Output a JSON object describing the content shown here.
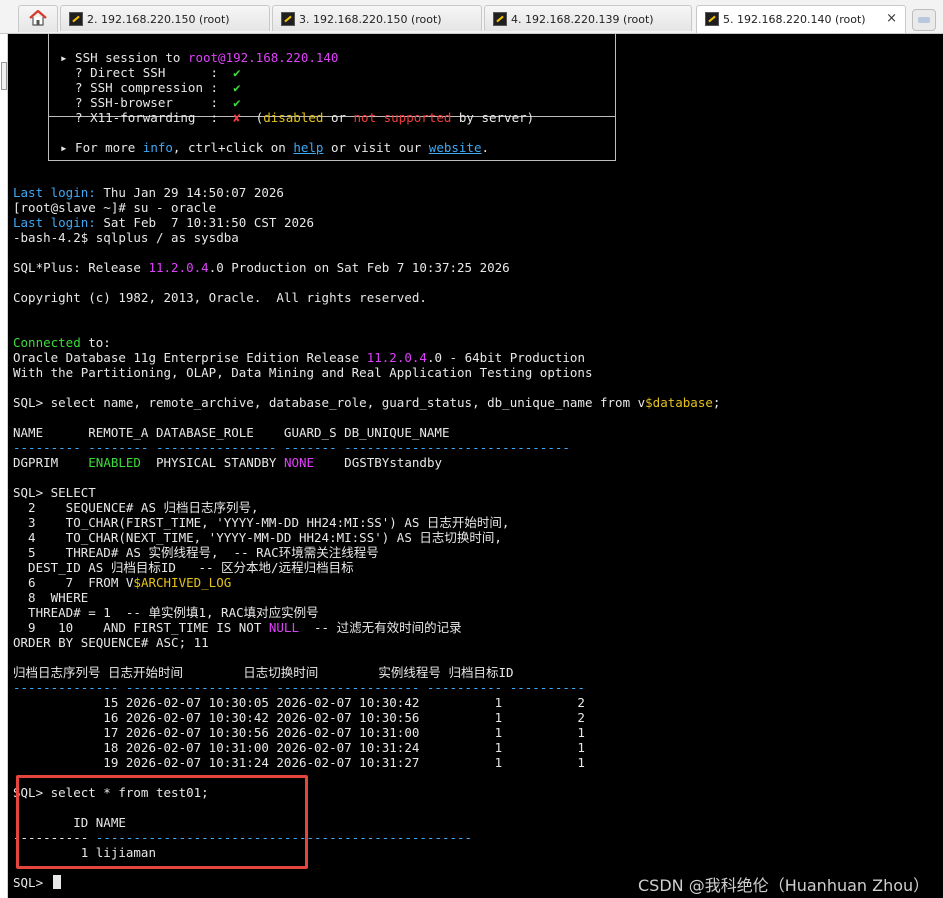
{
  "tabs": [
    {
      "label": "2. 192.168.220.150 (root)",
      "active": false
    },
    {
      "label": "3. 192.168.220.150 (root)",
      "active": false
    },
    {
      "label": "4. 192.168.220.139 (root)",
      "active": false
    },
    {
      "label": "5. 192.168.220.140 (root)",
      "active": true,
      "close": "×"
    }
  ],
  "icons": {
    "home": "home-icon",
    "tab": "terminal-tab-icon",
    "close": "close-icon",
    "new_tab": "new-tab-icon"
  },
  "colors": {
    "accent_magenta": "#e040fb",
    "accent_cyan": "#3fa9f5",
    "accent_green": "#3cdc3c",
    "accent_yellow": "#e4c21a",
    "accent_red": "#ef3b3b",
    "highlight_box": "#e4463d"
  },
  "terminal": {
    "info": {
      "l1_a": "▸ SSH session to ",
      "l1_b": "root@192.168.220.140",
      "l2": "  ? Direct SSH      :  ",
      "l3": "  ? SSH compression :  ",
      "l4": "  ? SSH-browser     :  ",
      "l5": "  ? X11-forwarding  :  ",
      "check": "✔",
      "cross": "✘",
      "l5_a": "  (",
      "l5_disabled": "disabled",
      "l5_or": " or ",
      "l5_notsupported": "not supported",
      "l5_b": " by server)",
      "more_a": "▸ For more ",
      "more_info": "info",
      "more_b": ", ctrl+click on ",
      "more_help": "help",
      "more_c": " or visit our ",
      "more_website": "website",
      "more_d": "."
    },
    "login1_a": "Last login:",
    "login1_b": " Thu Jan 29 14:50:07 2026",
    "su_cmd": "[root@slave ~]# su - oracle",
    "login2_a": "Last login:",
    "login2_b": " Sat Feb  7 10:31:50 CST 2026",
    "sqlplus_cmd": "-bash-4.2$ sqlplus / as sysdba",
    "release_a": "SQL*Plus: Release ",
    "release_ver": "11.2.0.4",
    "release_b": ".0 Production on Sat Feb 7 10:37:25 2026",
    "copyright": "Copyright (c) 1982, 2013, Oracle.  All rights reserved.",
    "connected_a": "Connected",
    "connected_b": " to:",
    "oracle_a": "Oracle Database 11g Enterprise Edition Release ",
    "oracle_ver": "11.2.0.4",
    "oracle_b": ".0 - 64bit Production",
    "options": "With the Partitioning, OLAP, Data Mining and Real Application Testing options",
    "q1_a": "SQL> select name, remote_archive, database_role, guard_status, db_unique_name from v",
    "q1_b": "$database",
    "q1_c": ";",
    "q1_header": "NAME      REMOTE_A DATABASE_ROLE    GUARD_S DB_UNIQUE_NAME",
    "q1_sep": "--------- -------- ---------------- ------- ------------------------------",
    "q1_row_a": "DGPRIM    ",
    "q1_row_enabled": "ENABLED",
    "q1_row_b": "  PHYSICAL STANDBY ",
    "q1_row_none": "NONE",
    "q1_row_c": "    DGSTBYstandby",
    "q2_l1": "SQL> SELECT",
    "q2_l2": "  2    SEQUENCE# AS 归档日志序列号,",
    "q2_l3": "  3    TO_CHAR(FIRST_TIME, 'YYYY-MM-DD HH24:MI:SS') AS 日志开始时间,",
    "q2_l4": "  4    TO_CHAR(NEXT_TIME, 'YYYY-MM-DD HH24:MI:SS') AS 日志切换时间,",
    "q2_l5": "  5    THREAD# AS 实例线程号,  -- RAC环境需关注线程号",
    "q2_l6": "  DEST_ID AS 归档目标ID   -- 区分本地/远程归档目标",
    "q2_l7_a": "  6    7  FROM V",
    "q2_l7_b": "$ARCHIVED_LOG",
    "q2_l8": "  8  WHERE",
    "q2_l9": "  THREAD# = 1  -- 单实例填1, RAC填对应实例号",
    "q2_l10_a": "  9   10    AND FIRST_TIME IS NOT ",
    "q2_l10_null": "NULL",
    "q2_l10_b": "  -- 过滤无有效时间的记录",
    "q2_l11": "ORDER BY SEQUENCE# ASC; 11",
    "q2_header": "归档日志序列号 日志开始时间        日志切换时间        实例线程号 归档目标ID",
    "q2_sep": "-------------- ------------------- ------------------- ---------- ----------",
    "q2_rows": [
      "            15 2026-02-07 10:30:05 2026-02-07 10:30:42          1          2",
      "            16 2026-02-07 10:30:42 2026-02-07 10:30:56          1          2",
      "            17 2026-02-07 10:30:56 2026-02-07 10:31:00          1          1",
      "            18 2026-02-07 10:31:00 2026-02-07 10:31:24          1          1",
      "            19 2026-02-07 10:31:24 2026-02-07 10:31:27          1          1"
    ],
    "q3": "SQL> select * from test01;",
    "q3_header": "        ID NAME",
    "q3_sep_a": "----------",
    "q3_sep_b": " --------------------------------------------------",
    "q3_row": "         1 lijiaman",
    "prompt": "SQL> "
  },
  "watermark": "CSDN @我科绝伦（Huanhuan Zhou）"
}
